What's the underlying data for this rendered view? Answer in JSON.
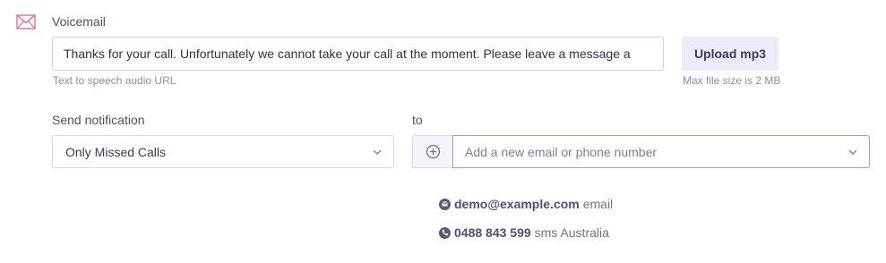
{
  "voicemail": {
    "title": "Voicemail",
    "message_value": "Thanks for your call. Unfortunately we cannot take your call at the moment. Please leave a message a",
    "hint": "Text to speech audio URL",
    "upload_label": "Upload mp3",
    "upload_hint": "Max file size is 2 MB"
  },
  "notification": {
    "label": "Send notification",
    "selected": "Only Missed Calls",
    "to_label": "to",
    "recipient_placeholder": "Add a new email or phone number"
  },
  "recipients": [
    {
      "value": "demo@example.com",
      "type": "email",
      "icon": "envelope-icon"
    },
    {
      "value": "0488 843 599",
      "type": "sms Australia",
      "icon": "phone-icon"
    }
  ],
  "colors": {
    "accent": "#e06b86",
    "upload_bg": "#ecebfa",
    "focus_border": "#9e9ad6",
    "recipient_text": "#4f4e7c"
  }
}
